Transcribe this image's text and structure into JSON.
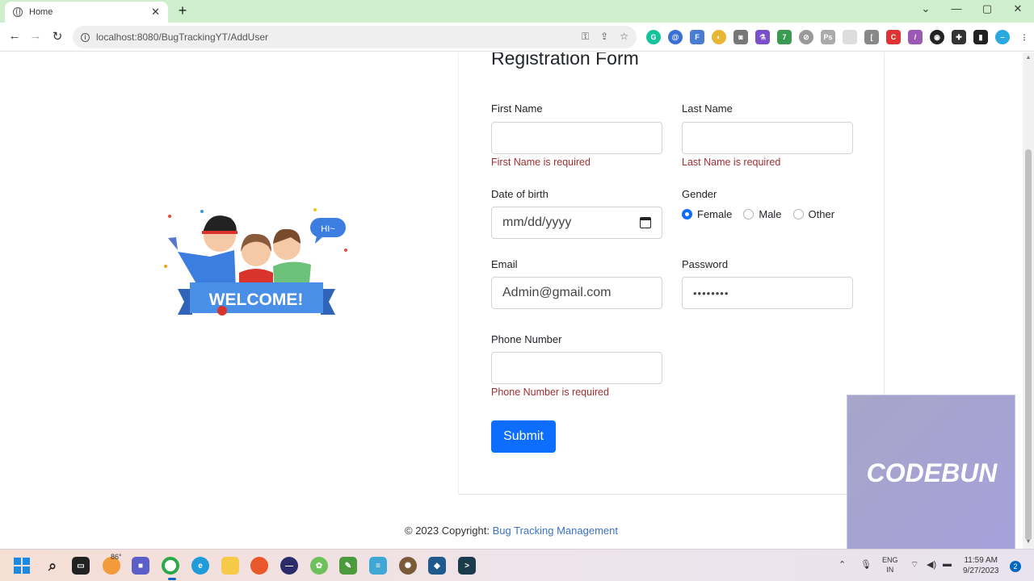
{
  "browser": {
    "tab_title": "Home",
    "url": "localhost:8080/BugTrackingYT/AddUser"
  },
  "form": {
    "title": "Registration Form",
    "first_name_label": "First Name",
    "first_name_value": "",
    "first_name_error": "First Name is required",
    "last_name_label": "Last Name",
    "last_name_value": "",
    "last_name_error": "Last Name is required",
    "dob_label": "Date of birth",
    "dob_placeholder": "mm/dd/yyyy",
    "gender_label": "Gender",
    "gender_options": [
      "Female",
      "Male",
      "Other"
    ],
    "gender_selected": "Female",
    "email_label": "Email",
    "email_value": "Admin@gmail.com",
    "password_label": "Password",
    "password_value": "••••••••",
    "phone_label": "Phone Number",
    "phone_value": "",
    "phone_error": "Phone Number is required",
    "submit_label": "Submit"
  },
  "illustration": {
    "speech": "HI~",
    "banner": "WELCOME!"
  },
  "footer": {
    "prefix": "© 2023 Copyright: ",
    "link": "Bug Tracking Management"
  },
  "overlay": {
    "text": "CODEBUN"
  },
  "taskbar": {
    "weather": "86°",
    "lang_top": "ENG",
    "lang_bottom": "IN",
    "time": "11:59 AM",
    "date": "9/27/2023",
    "notifications": "2"
  },
  "colors": {
    "primary": "#0d6efd",
    "error": "#a12f33",
    "link": "#3b71ca",
    "tab_strip": "#cfeecb"
  }
}
